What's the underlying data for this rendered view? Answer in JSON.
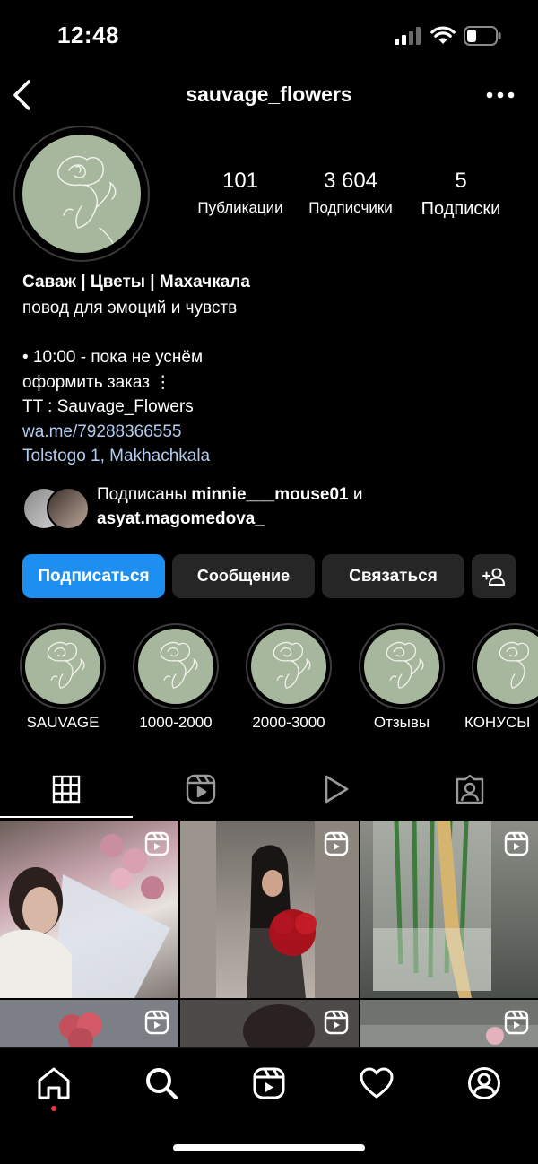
{
  "status_bar": {
    "time": "12:48",
    "icons": [
      "cellular-signal-icon",
      "wifi-icon",
      "battery-icon"
    ]
  },
  "header": {
    "username": "sauvage_flowers",
    "back_icon": "chevron-left-icon",
    "more_icon": "ellipsis-icon"
  },
  "profile": {
    "stats": [
      {
        "number": "101",
        "label": "Публикации"
      },
      {
        "number": "3 604",
        "label": "Подписчики"
      },
      {
        "number": "5",
        "label": "Подписки"
      }
    ],
    "bio": {
      "name": "Саваж | Цветы | Махачкала",
      "tagline": "повод для эмоций и чувств",
      "hours": "• 10:00 - пока не уснём",
      "order": "оформить заказ ⋮",
      "tt": "TT : Sauvage_Flowers",
      "link": "wa.me/79288366555",
      "address": "Tolstogo 1, Makhachkala"
    },
    "followed_by": {
      "prefix": "Подписаны ",
      "user1": "minnie___mouse01",
      "joiner": " и",
      "user2": "asyat.magomedova_"
    }
  },
  "actions": {
    "follow": "Подписаться",
    "message": "Сообщение",
    "contact": "Связаться",
    "add_user_icon": "add-person-icon"
  },
  "highlights": [
    {
      "label": "SAUVAGE"
    },
    {
      "label": "1000-2000"
    },
    {
      "label": "2000-3000"
    },
    {
      "label": "Отзывы"
    },
    {
      "label": "КОНУСЫ"
    }
  ],
  "tabs": [
    "grid-icon",
    "reels-icon",
    "play-icon",
    "tagged-icon"
  ],
  "bottom_nav": [
    "home-icon",
    "search-icon",
    "reels-icon",
    "heart-icon",
    "profile-icon"
  ],
  "colors": {
    "accent": "#1c8ff0",
    "link": "#b4cdee",
    "avatar_bg": "#a7b79d",
    "button_bg": "#262626"
  }
}
